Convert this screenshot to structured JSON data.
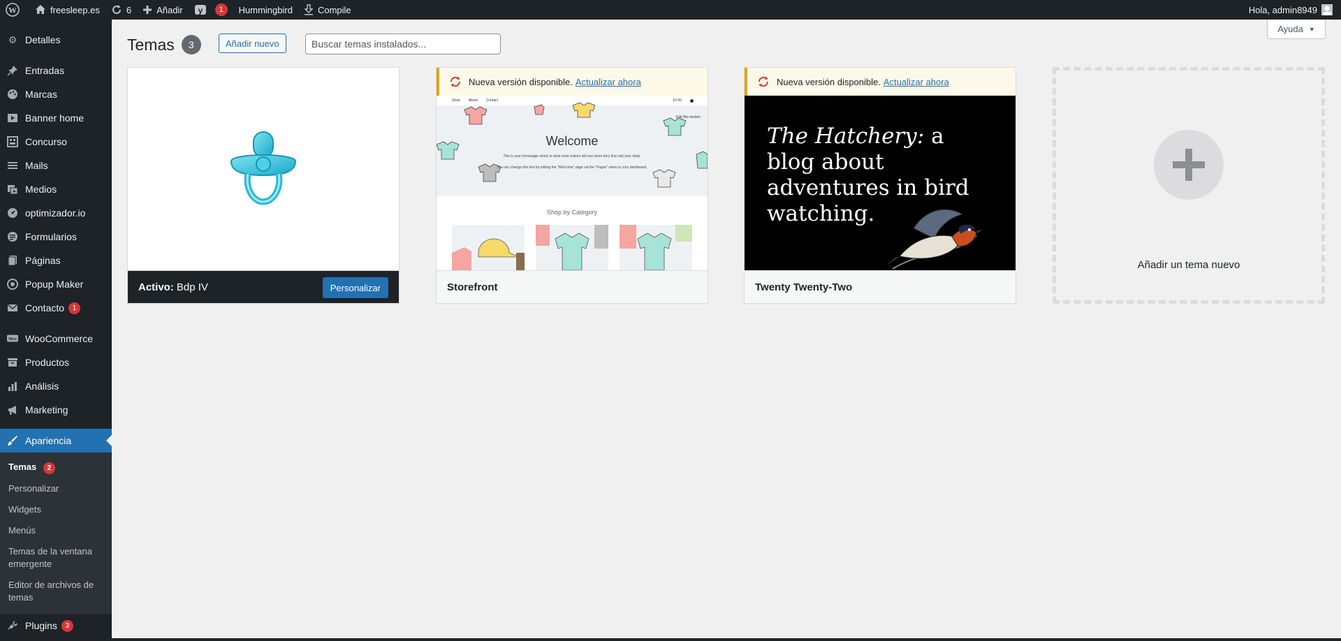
{
  "adminbar": {
    "site_name": "freesleep.es",
    "updates_count": "6",
    "add_label": "Añadir",
    "yoast_badge": "1",
    "hummingbird_label": "Hummingbird",
    "compile_label": "Compile",
    "greeting": "Hola, admin8949"
  },
  "sidebar": {
    "items": [
      {
        "label": "Detalles",
        "icon": "gear-icon"
      },
      {
        "label": "Entradas",
        "icon": "pin-icon"
      },
      {
        "label": "Marcas",
        "icon": "palette-icon"
      },
      {
        "label": "Banner home",
        "icon": "play-icon"
      },
      {
        "label": "Concurso",
        "icon": "grid-icon"
      },
      {
        "label": "Mails",
        "icon": "list-icon"
      },
      {
        "label": "Medios",
        "icon": "media-icon"
      },
      {
        "label": "optimizador.io",
        "icon": "gauge-icon"
      },
      {
        "label": "Formularios",
        "icon": "form-icon"
      },
      {
        "label": "Páginas",
        "icon": "page-icon"
      },
      {
        "label": "Popup Maker",
        "icon": "popup-icon"
      },
      {
        "label": "Contacto",
        "icon": "mail-icon",
        "badge": "1"
      },
      {
        "label": "WooCommerce",
        "icon": "woo-icon"
      },
      {
        "label": "Productos",
        "icon": "archive-icon"
      },
      {
        "label": "Análisis",
        "icon": "chart-icon"
      },
      {
        "label": "Marketing",
        "icon": "megaphone-icon"
      },
      {
        "label": "Apariencia",
        "icon": "brush-icon"
      },
      {
        "label": "Plugins",
        "icon": "plug-icon",
        "badge": "3"
      }
    ],
    "submenu": [
      {
        "label": "Temas",
        "badge": "2"
      },
      {
        "label": "Personalizar"
      },
      {
        "label": "Widgets"
      },
      {
        "label": "Menús"
      },
      {
        "label": "Temas de la ventana emergente"
      },
      {
        "label": "Editor de archivos de temas"
      }
    ]
  },
  "header": {
    "title": "Temas",
    "count": "3",
    "add_new_label": "Añadir nuevo",
    "search_placeholder": "Buscar temas instalados...",
    "help_label": "Ayuda"
  },
  "themes": [
    {
      "active_prefix": "Activo:",
      "name": "Bdp IV",
      "customize_label": "Personalizar"
    },
    {
      "name": "Storefront",
      "notice": "Nueva versión disponible.",
      "notice_link": "Actualizar ahora",
      "preview": {
        "nav": [
          "Shop",
          "About",
          "Contact"
        ],
        "cart": "£0.00",
        "edit": "Edit this section",
        "welcome": "Welcome",
        "line1": "This is your homepage which is what most visitors will see when they first visit your shop.",
        "line2": "You can change this text by editing the \"Welcome\" page via the \"Pages\" menu in your dashboard.",
        "shop_by": "Shop by Category"
      }
    },
    {
      "name": "Twenty Twenty-Two",
      "notice": "Nueva versión disponible.",
      "notice_link": "Actualizar ahora",
      "preview": {
        "hatchery": "The Hatchery:",
        "tagline": " a blog about adventures in bird watching."
      }
    }
  ],
  "add_theme": {
    "label": "Añadir un tema nuevo"
  },
  "colors": {
    "admin_dark": "#1d2327",
    "accent": "#2271b1",
    "badge_red": "#d63638",
    "notice_yellow": "#dba617"
  }
}
